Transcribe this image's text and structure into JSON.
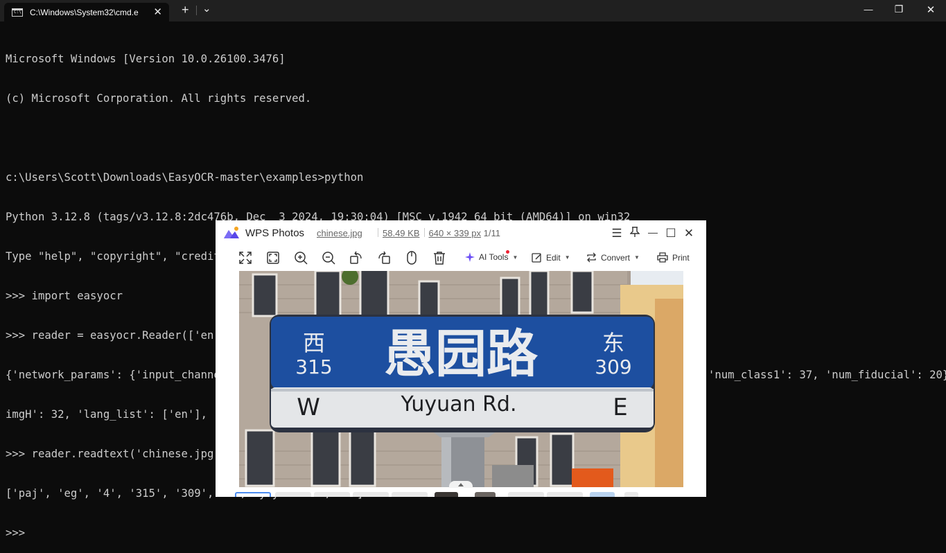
{
  "terminal_tab": {
    "title": "C:\\Windows\\System32\\cmd.e",
    "icon_text": "C:\\",
    "close_glyph": "✕",
    "new_tab_glyph": "+",
    "dropdown_glyph": "⌄"
  },
  "window_controls": {
    "minimize": "—",
    "restore": "❐",
    "close": "✕"
  },
  "terminal_lines": [
    "Microsoft Windows [Version 10.0.26100.3476]",
    "(c) Microsoft Corporation. All rights reserved.",
    "",
    "c:\\Users\\Scott\\Downloads\\EasyOCR-master\\examples>python",
    "Python 3.12.8 (tags/v3.12.8:2dc476b, Dec  3 2024, 19:30:04) [MSC v.1942 64 bit (AMD64)] on win32",
    "Type \"help\", \"copyright\", \"credits\" or \"license\" for more information.",
    ">>> import easyocr",
    ">>> reader = easyocr.Reader(['en'], recog_network='best_accuracy')",
    "{'network_params': {'input_channel': 1, 'output_channel': 512, 'hidden_size': 256, 'imgH': 32, 'imgW': 100, 'num_class1': 37, 'num_fiducial': 20}, '",
    "imgH': 32, 'lang_list': ['en'], 'character_list': '0123456789abcdefghijklmnopqrstuvwxyz'}",
    ">>> reader.readtext('chinese.jpg', detail = 0)",
    "['paj', 'eg', '4', '315', '309', 'w', 'yuyuantrd', 'e']",
    ">>>"
  ],
  "wps": {
    "app_name": "WPS Photos",
    "file_name": "chinese.jpg",
    "file_size": "58.49 KB",
    "dimensions": "640 × 339 px",
    "page": "1/11",
    "toolbar": {
      "ai_tools": "AI Tools",
      "edit": "Edit",
      "convert": "Convert",
      "print": "Print"
    },
    "window_glyphs": {
      "menu": "☰",
      "pin": "⊥",
      "minimize": "—",
      "maximize": "☐",
      "close": "✕"
    }
  },
  "photo_sign": {
    "chinese_main": "愚园路",
    "west_char": "西",
    "west_number": "315",
    "east_char": "东",
    "east_number": "309",
    "west_letter": "W",
    "english_name": "Yuyuan Rd.",
    "east_letter": "E"
  },
  "colors": {
    "terminal_bg": "#0c0c0c",
    "terminal_text": "#cccccc",
    "tabbar_bg": "#202020",
    "sign_blue": "#1d4fa0",
    "accent": "#4b8cf0"
  }
}
